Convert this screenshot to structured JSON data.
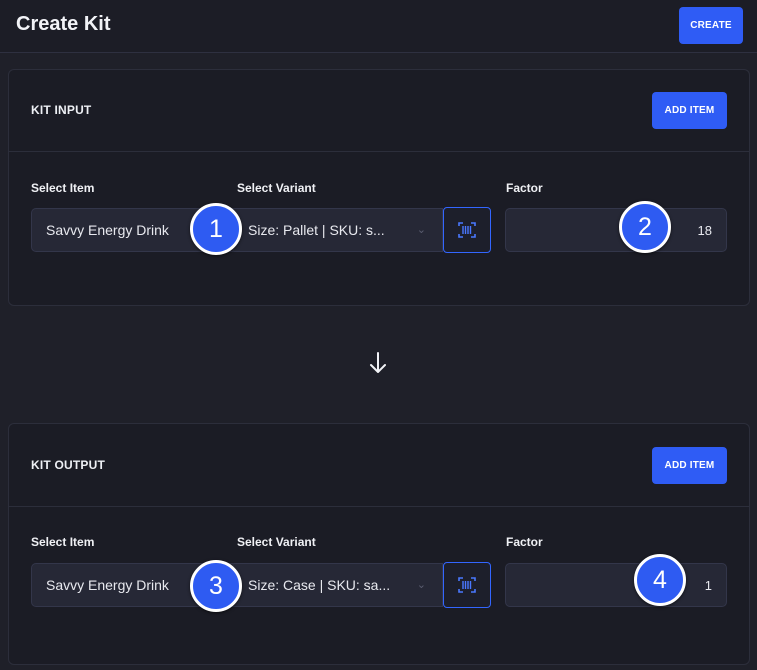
{
  "header": {
    "title": "Create Kit",
    "create_label": "CREATE"
  },
  "kit_input": {
    "title": "KIT INPUT",
    "add_item_label": "ADD ITEM",
    "select_item_label": "Select Item",
    "select_variant_label": "Select Variant",
    "factor_label": "Factor",
    "item_value": "Savvy Energy Drink",
    "variant_value": "Size: Pallet | SKU: s...",
    "factor_value": "18"
  },
  "kit_output": {
    "title": "KIT OUTPUT",
    "add_item_label": "ADD ITEM",
    "select_item_label": "Select Item",
    "select_variant_label": "Select Variant",
    "factor_label": "Factor",
    "item_value": "Savvy Energy Drink",
    "variant_value": "Size: Case | SKU: sa...",
    "factor_value": "1"
  },
  "badges": [
    "1",
    "2",
    "3",
    "4"
  ],
  "icons": {
    "scan": "barcode-scan-icon",
    "chevron": "chevron-down-icon",
    "arrow": "arrow-down-icon"
  },
  "colors": {
    "accent": "#2f5cf5",
    "background": "#1f2029",
    "card": "#1b1c25"
  }
}
